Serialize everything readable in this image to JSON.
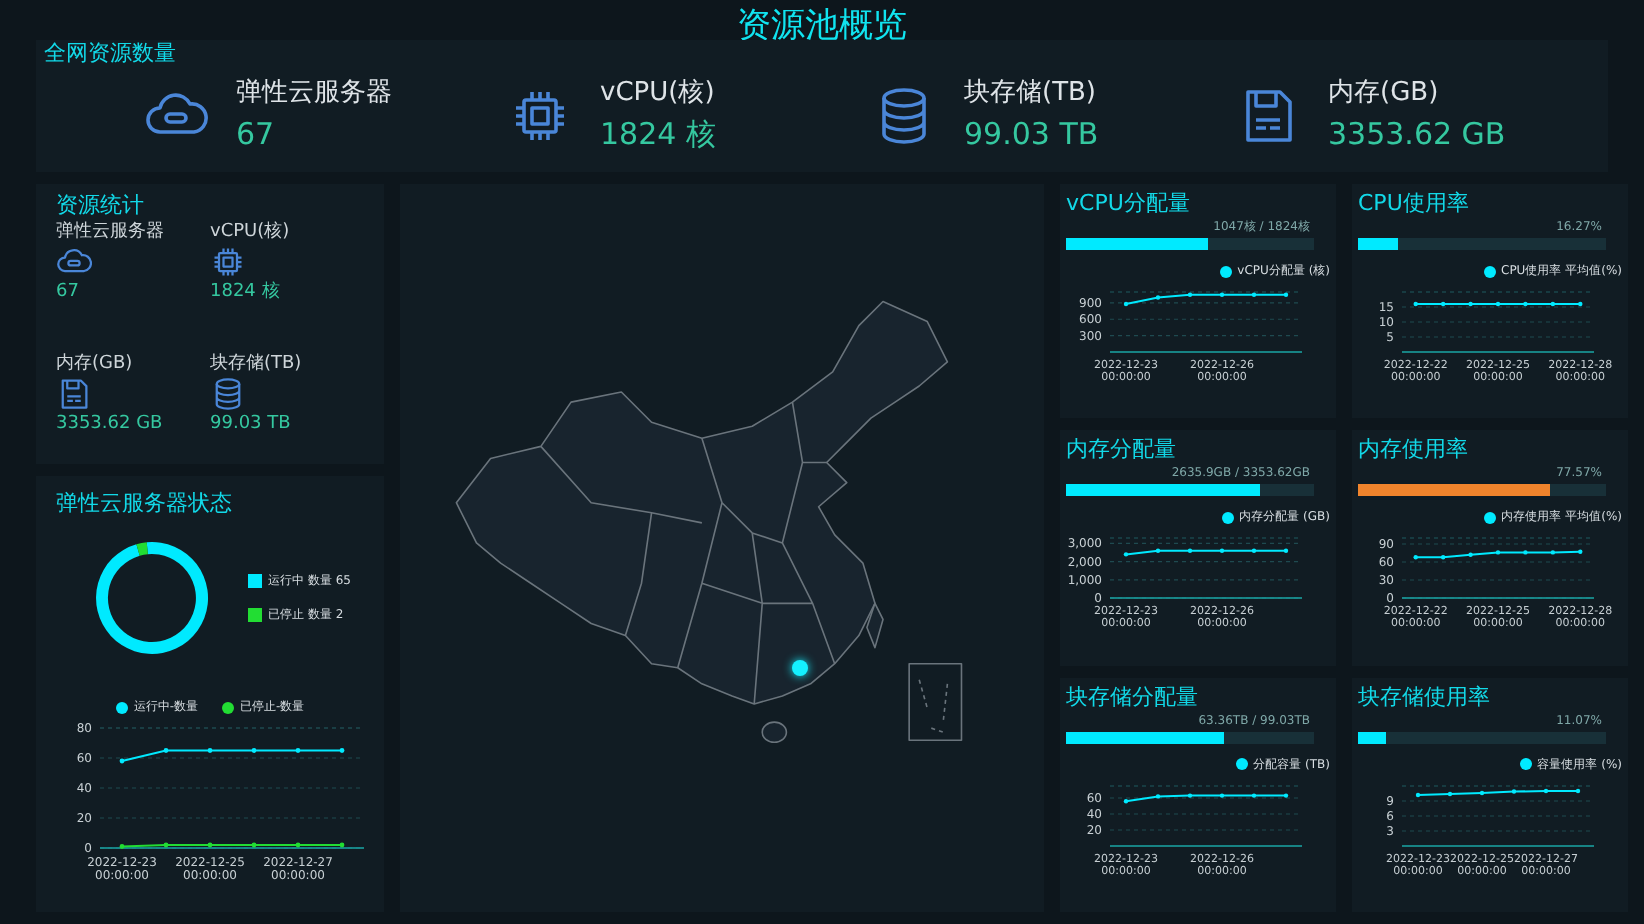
{
  "page_title": "资源池概览",
  "overview": {
    "title": "全网资源数量",
    "stats": [
      {
        "kind": "cloud",
        "label": "弹性云服务器",
        "value": "67"
      },
      {
        "kind": "cpu",
        "label": "vCPU(核)",
        "value": "1824 核"
      },
      {
        "kind": "database",
        "label": "块存储(TB)",
        "value": "99.03 TB"
      },
      {
        "kind": "floppy",
        "label": "内存(GB)",
        "value": "3353.62 GB"
      }
    ]
  },
  "resource_stats": {
    "title": "资源统计",
    "items": [
      {
        "kind": "cloud",
        "label": "弹性云服务器",
        "value": "67"
      },
      {
        "kind": "cpu",
        "label": "vCPU(核)",
        "value": "1824 核"
      },
      {
        "kind": "floppy",
        "label": "内存(GB)",
        "value": "3353.62 GB"
      },
      {
        "kind": "database",
        "label": "块存储(TB)",
        "value": "99.03 TB"
      }
    ]
  },
  "vm_status": {
    "title": "弹性云服务器状态",
    "legend": [
      {
        "label": "运行中 数量 65",
        "color": "#00eaff"
      },
      {
        "label": "已停止 数量 2",
        "color": "#22dd33"
      }
    ],
    "donut": {
      "chart_data": {
        "type": "donut",
        "values": [
          97,
          3
        ]
      }
    },
    "trend": {
      "chart_data": {
        "type": "line",
        "grid": true,
        "categories": [
          "2022-12-23 00:00:00",
          null,
          "2022-12-25 00:00:00",
          null,
          "2022-12-27 00:00:00",
          null
        ],
        "ylim": [
          0,
          80
        ],
        "yticks": [
          0,
          20,
          40,
          60,
          80
        ],
        "series": [
          {
            "name": "运行中-数量",
            "color": "#00eaff",
            "values": [
              58,
              65,
              65,
              65,
              65,
              65
            ]
          },
          {
            "name": "已停止-数量",
            "color": "#22dd33",
            "values": [
              1,
              2,
              2,
              2,
              2,
              2
            ]
          }
        ]
      }
    }
  },
  "map": {
    "marker": {
      "kind": "dot"
    }
  },
  "panels": [
    {
      "title": "vCPU分配量",
      "ratio": "1047核 / 1824核",
      "level": 0.574,
      "color": "#00eaff",
      "chart_data": {
        "type": "line",
        "grid": true,
        "categories": [
          "2022-12-23 00:00:00",
          null,
          null,
          "2022-12-26 00:00:00",
          null,
          null
        ],
        "ylim": [
          0,
          1100
        ],
        "yticks": [
          300,
          600,
          900
        ],
        "series": [
          {
            "name": "vCPU分配量 (核)",
            "color": "#00eaff",
            "values": [
              880,
              1000,
              1050,
              1050,
              1050,
              1050
            ]
          }
        ]
      }
    },
    {
      "title": "CPU使用率",
      "ratio": "16.27%",
      "level": 0.1627,
      "color": "#00eaff",
      "chart_data": {
        "type": "line",
        "grid": true,
        "categories": [
          "2022-12-22 00:00:00",
          null,
          null,
          "2022-12-25 00:00:00",
          null,
          null,
          "2022-12-28 00:00:00"
        ],
        "ylim": [
          0,
          20
        ],
        "yticks": [
          5,
          10,
          15
        ],
        "series": [
          {
            "name": "CPU使用率 平均值(%)",
            "color": "#00eaff",
            "values": [
              16,
              16,
              16,
              16,
              16,
              16,
              16
            ]
          }
        ]
      }
    },
    {
      "title": "内存分配量",
      "ratio": "2635.9GB / 3353.62GB",
      "level": 0.786,
      "color": "#00eaff",
      "chart_data": {
        "type": "line",
        "grid": true,
        "categories": [
          "2022-12-23 00:00:00",
          null,
          null,
          "2022-12-26 00:00:00",
          null,
          null
        ],
        "ylim": [
          0,
          3300
        ],
        "yticks": [
          0,
          {
            "value": 1000,
            "label": "1,000"
          },
          {
            "value": 2000,
            "label": "2,000"
          },
          {
            "value": 3000,
            "label": "3,000"
          }
        ],
        "series": [
          {
            "name": "内存分配量 (GB)",
            "color": "#00eaff",
            "values": [
              2400,
              2600,
              2600,
              2600,
              2600,
              2600
            ]
          }
        ]
      }
    },
    {
      "title": "内存使用率",
      "ratio": "77.57%",
      "level": 0.7757,
      "color": "#f0842c",
      "chart_data": {
        "type": "line",
        "grid": true,
        "categories": [
          "2022-12-22 00:00:00",
          null,
          null,
          "2022-12-25 00:00:00",
          null,
          null,
          "2022-12-28 00:00:00"
        ],
        "ylim": [
          0,
          100
        ],
        "yticks": [
          0,
          30,
          60,
          90
        ],
        "series": [
          {
            "name": "内存使用率 平均值(%)",
            "color": "#00eaff",
            "values": [
              68,
              68,
              72,
              76,
              76,
              76,
              77
            ]
          }
        ]
      }
    },
    {
      "title": "块存储分配量",
      "ratio": "63.36TB / 99.03TB",
      "level": 0.64,
      "color": "#00eaff",
      "chart_data": {
        "type": "line",
        "grid": true,
        "categories": [
          "2022-12-23 00:00:00",
          null,
          null,
          "2022-12-26 00:00:00",
          null,
          null
        ],
        "ylim": [
          0,
          75
        ],
        "yticks": [
          20,
          40,
          60
        ],
        "series": [
          {
            "name": "分配容量 (TB)",
            "color": "#00eaff",
            "values": [
              56,
              62,
              63,
              63,
              63,
              63
            ]
          }
        ]
      }
    },
    {
      "title": "块存储使用率",
      "ratio": "11.07%",
      "level": 0.1107,
      "color": "#00eaff",
      "chart_data": {
        "type": "line",
        "grid": true,
        "categories": [
          "2022-12-23 00:00:00",
          null,
          "2022-12-25 00:00:00",
          null,
          "2022-12-27 00:00:00",
          null
        ],
        "ylim": [
          0,
          12
        ],
        "yticks": [
          3,
          6,
          9
        ],
        "series": [
          {
            "name": "容量使用率 (%)",
            "color": "#00eaff",
            "values": [
              10.2,
              10.4,
              10.6,
              10.9,
              11,
              11
            ]
          }
        ]
      }
    }
  ]
}
